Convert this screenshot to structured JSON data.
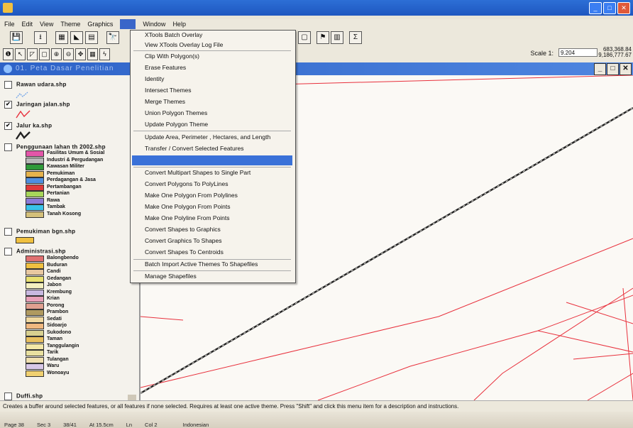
{
  "menus": [
    "File",
    "Edit",
    "View",
    "Theme",
    "Graphics",
    "",
    "Window",
    "Help"
  ],
  "toolbar1": [
    "💾",
    "⭳",
    "▦",
    "◣",
    "▤",
    "🔭",
    "▢",
    "⚑",
    "▥",
    "Σ"
  ],
  "toolbar2": [
    "❶",
    "↖",
    "◸",
    "▢",
    "⊕",
    "⊖",
    "✥",
    "▦",
    "ϟ"
  ],
  "scale": {
    "label": "Scale 1:",
    "value": "9.204"
  },
  "coords": [
    "683,368.84",
    "9,186,777.67"
  ],
  "view_title": "01. Peta Dasar Penelitian",
  "legend": {
    "themes": [
      {
        "name": "Rawan udara.shp",
        "checked": false
      },
      {
        "name": "Jaringan jalan.shp",
        "checked": true
      },
      {
        "name": "Jalur ka.shp",
        "checked": true
      },
      {
        "name": "Penggunaan lahan th 2002.shp",
        "checked": false
      },
      {
        "name": "Pemukiman bgn.shp",
        "checked": false
      },
      {
        "name": "Administrasi.shp",
        "checked": false
      },
      {
        "name": "Duffi.shp",
        "checked": false
      }
    ],
    "landuse": [
      {
        "label": "Fasilitas Umum & Sosial",
        "color": "#e356a8"
      },
      {
        "label": "Industri & Pergudangan",
        "color": "#b9b9b9"
      },
      {
        "label": "Kawasan Militer",
        "color": "#2f9a3a"
      },
      {
        "label": "Pemukiman",
        "color": "#e6b34c"
      },
      {
        "label": "Perdagangan & Jasa",
        "color": "#4f8fe0"
      },
      {
        "label": "Pertambangan",
        "color": "#e03a3a"
      },
      {
        "label": "Pertanian",
        "color": "#a7d65a"
      },
      {
        "label": "Rawa",
        "color": "#8c7ad8"
      },
      {
        "label": "Tambak",
        "color": "#39c2e8"
      },
      {
        "label": "Tanah Kosong",
        "color": "#d4c07a"
      }
    ],
    "admin": [
      {
        "label": "Balongbendo",
        "color": "#e07070"
      },
      {
        "label": "Buduran",
        "color": "#f0c040"
      },
      {
        "label": "Candi",
        "color": "#e8c8a0"
      },
      {
        "label": "Gedangan",
        "color": "#e8e070"
      },
      {
        "label": "Jabon",
        "color": "#f4f0c0"
      },
      {
        "label": "Krembung",
        "color": "#c8b8e0"
      },
      {
        "label": "Krian",
        "color": "#e8a0b8"
      },
      {
        "label": "Porong",
        "color": "#e0a090"
      },
      {
        "label": "Prambon",
        "color": "#b09a60"
      },
      {
        "label": "Sedati",
        "color": "#f0d8a0"
      },
      {
        "label": "Sidoarjo",
        "color": "#f0b880"
      },
      {
        "label": "Sukodono",
        "color": "#d8d090"
      },
      {
        "label": "Taman",
        "color": "#e8c060"
      },
      {
        "label": "Tanggulangin",
        "color": "#f4e8a8"
      },
      {
        "label": "Tarik",
        "color": "#e8e0a0"
      },
      {
        "label": "Tulangan",
        "color": "#f0e0b0"
      },
      {
        "label": "Waru",
        "color": "#d8c8e8"
      },
      {
        "label": "Wonoayu",
        "color": "#f0d070"
      }
    ],
    "pemukiman_color": "#f0c040"
  },
  "dropdown": [
    "XTools Batch Overlay",
    "View XTools Overlay Log File",
    "Clip With Polygon(s)",
    "Erase Features",
    "Identity",
    "Intersect Themes",
    "Merge Themes",
    "Union Polygon Themes",
    "Update Polygon Theme",
    "Update Area, Perimeter , Hectares, and Length",
    "Transfer / Convert Selected Features",
    "Convert Multipart Shapes to Single Part",
    "Convert Polygons To PolyLines",
    "Make One Polygon From Polylines",
    "Make One Polygon From Points",
    "Make One Polyline From Points",
    "Convert Shapes to Graphics",
    "Convert Graphics To Shapes",
    "Convert Shapes To Centroids",
    "Batch Import Active Themes To Shapefiles",
    "Manage Shapefiles"
  ],
  "status_text": "Creates a buffer around selected features, or all features if none selected.  Requires at least one active theme.  Press \"Shift\" and click this menu item for a description and instructions.",
  "word_status": [
    "Page 38",
    "Sec 3",
    "38/41",
    "At 15.5cm",
    "Ln",
    "Col 2",
    "",
    "Indonesian"
  ],
  "colors": {
    "road": "#e8303c",
    "rail": "#222222",
    "titlebar": "#1e56c0",
    "highlight": "#3a71d8"
  }
}
